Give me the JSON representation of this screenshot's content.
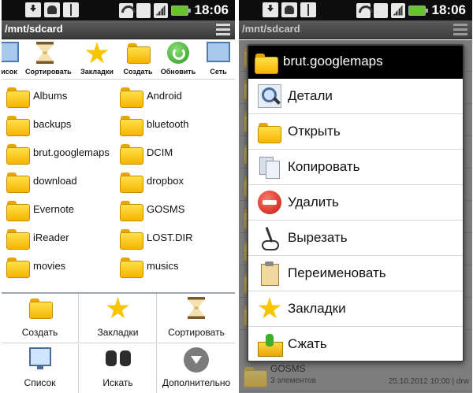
{
  "status": {
    "time": "18:06"
  },
  "left": {
    "path": "/mnt/sdcard",
    "toolbar": [
      {
        "label": "сисок",
        "icon": "list-icon"
      },
      {
        "label": "Сортировать",
        "icon": "hourglass-icon"
      },
      {
        "label": "Закладки",
        "icon": "star-icon"
      },
      {
        "label": "Создать",
        "icon": "folder-add-icon"
      },
      {
        "label": "Обновить",
        "icon": "refresh-icon"
      },
      {
        "label": "Сеть",
        "icon": "network-icon"
      }
    ],
    "folders": [
      [
        "Albums",
        "Android"
      ],
      [
        "backups",
        "bluetooth"
      ],
      [
        "brut.googlemaps",
        "DCIM"
      ],
      [
        "download",
        "dropbox"
      ],
      [
        "Evernote",
        "GOSMS"
      ],
      [
        "iReader",
        "LOST.DIR"
      ],
      [
        "movies",
        "musics"
      ]
    ],
    "bottom_menu": [
      {
        "label": "Создать",
        "icon": "folder-add-icon"
      },
      {
        "label": "Закладки",
        "icon": "star-icon"
      },
      {
        "label": "Сортировать",
        "icon": "hourglass-icon"
      },
      {
        "label": "Список",
        "icon": "monitor-icon"
      },
      {
        "label": "Искать",
        "icon": "binoculars-icon"
      },
      {
        "label": "Дополнительно",
        "icon": "more-icon"
      }
    ]
  },
  "right": {
    "path": "/mnt/sdcard",
    "context": {
      "title": "brut.googlemaps",
      "items": [
        {
          "label": "Детали",
          "icon": "magnifier-icon"
        },
        {
          "label": "Открыть",
          "icon": "folder-icon"
        },
        {
          "label": "Копировать",
          "icon": "copy-icon"
        },
        {
          "label": "Удалить",
          "icon": "delete-icon"
        },
        {
          "label": "Вырезать",
          "icon": "scissors-icon"
        },
        {
          "label": "Переименовать",
          "icon": "clipboard-icon"
        },
        {
          "label": "Закладки",
          "icon": "star-icon"
        },
        {
          "label": "Сжать",
          "icon": "archive-icon"
        }
      ]
    },
    "bg_row": {
      "name": "GOSMS",
      "sub": "3 элементов",
      "meta": "25.10.2012 10:00 | drw"
    }
  },
  "colors": {
    "statusbar": "#0d0d0d",
    "battery": "#67c32b",
    "folder": "#f5b400",
    "context_header": "#000000"
  }
}
